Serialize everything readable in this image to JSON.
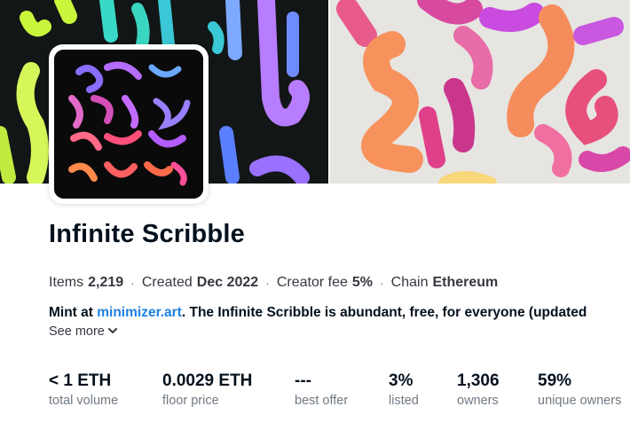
{
  "collection": {
    "title": "Infinite Scribble",
    "meta": [
      {
        "label": "Items",
        "value": "2,219"
      },
      {
        "label": "Created",
        "value": "Dec 2022"
      },
      {
        "label": "Creator fee",
        "value": "5%"
      },
      {
        "label": "Chain",
        "value": "Ethereum"
      }
    ],
    "meta_separator": "·",
    "description": {
      "prefix": "Mint at ",
      "link": "minimizer.art",
      "suffix": ". The Infinite Scribble is abundant, free, for everyone (updated"
    },
    "see_more": "See more",
    "see_more_icon": "chevron-down-icon"
  },
  "stats": [
    {
      "value": "< 1 ETH",
      "label": "total volume"
    },
    {
      "value": "0.0029 ETH",
      "label": "floor price"
    },
    {
      "value": "---",
      "label": "best offer"
    },
    {
      "value": "3%",
      "label": "listed"
    },
    {
      "value": "1,306",
      "label": "owners"
    },
    {
      "value": "59%",
      "label": "unique owners"
    }
  ],
  "colors": {
    "link": "#2081e2",
    "text": "#04111d",
    "muted": "#707a83"
  }
}
